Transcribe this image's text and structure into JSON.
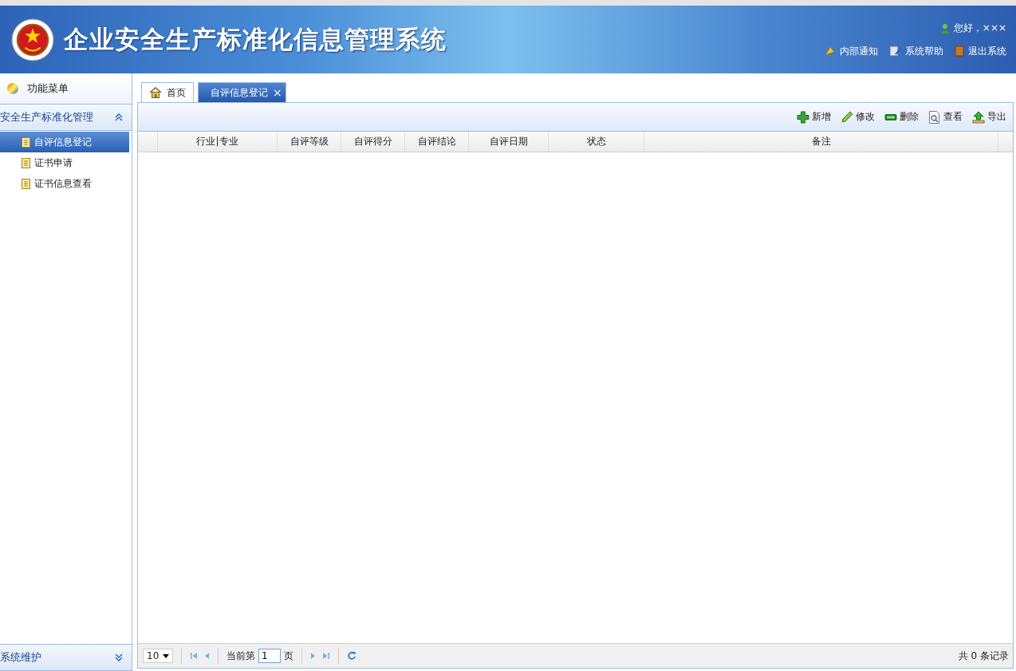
{
  "header": {
    "title": "企业安全生产标准化信息管理系统",
    "greeting": "您好，×××",
    "links": [
      {
        "kind": "notice",
        "label": "内部通知"
      },
      {
        "kind": "help",
        "label": "系统帮助"
      },
      {
        "kind": "logout",
        "label": "退出系统"
      }
    ]
  },
  "sidebar": {
    "title": "功能菜单",
    "groups": [
      {
        "label": "安全生产标准化管理",
        "expanded": true,
        "items": [
          {
            "label": "自评信息登记",
            "selected": true
          },
          {
            "label": "证书申请",
            "selected": false
          },
          {
            "label": "证书信息查看",
            "selected": false
          }
        ]
      },
      {
        "label": "系统维护",
        "expanded": false
      }
    ]
  },
  "tabs": [
    {
      "kind": "home",
      "label": "首页",
      "selected": false
    },
    {
      "kind": "page",
      "label": "自评信息登记",
      "selected": true,
      "close": "×"
    }
  ],
  "toolbar": [
    {
      "kind": "add",
      "label": "新增"
    },
    {
      "kind": "edit",
      "label": "修改"
    },
    {
      "kind": "delete",
      "label": "删除"
    },
    {
      "kind": "view",
      "label": "查看"
    },
    {
      "kind": "export",
      "label": "导出"
    }
  ],
  "table": {
    "columns": [
      "行业|专业",
      "自评等级",
      "自评得分",
      "自评结论",
      "自评日期",
      "状态",
      "备注"
    ]
  },
  "pager": {
    "page_size": "10",
    "before": "当前第",
    "page": "1",
    "after": "页",
    "summary": "共 0 条记录"
  }
}
